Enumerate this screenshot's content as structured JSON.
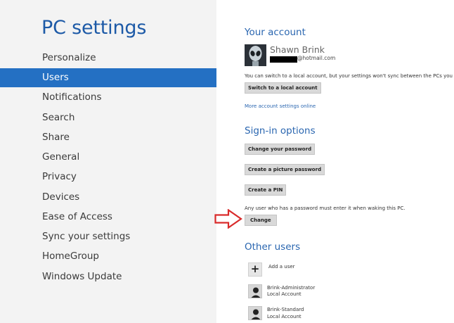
{
  "title": "PC settings",
  "nav": {
    "items": [
      {
        "label": "Personalize"
      },
      {
        "label": "Users"
      },
      {
        "label": "Notifications"
      },
      {
        "label": "Search"
      },
      {
        "label": "Share"
      },
      {
        "label": "General"
      },
      {
        "label": "Privacy"
      },
      {
        "label": "Devices"
      },
      {
        "label": "Ease of Access"
      },
      {
        "label": "Sync your settings"
      },
      {
        "label": "HomeGroup"
      },
      {
        "label": "Windows Update"
      }
    ],
    "selected": "Users"
  },
  "account": {
    "heading": "Your account",
    "user_name": "Shawn Brink",
    "email_domain": "@hotmail.com",
    "info": "You can switch to a local account, but your settings won't sync between the PCs you use.",
    "switch_button": "Switch to a local account",
    "more_link": "More account settings online"
  },
  "signin": {
    "heading": "Sign-in options",
    "change_password_button": "Change your password",
    "picture_password_button": "Create a picture password",
    "pin_button": "Create a PIN",
    "wake_text": "Any user who has a password must enter it when waking this PC.",
    "change_button": "Change"
  },
  "other_users": {
    "heading": "Other users",
    "add_label": "Add a user",
    "add_symbol": "+",
    "users": [
      {
        "name": "Brink-Administrator",
        "type": "Local Account"
      },
      {
        "name": "Brink-Standard",
        "type": "Local Account"
      }
    ]
  },
  "colors": {
    "accent": "#2470c3",
    "heading": "#2a66b0",
    "arrow": "#d92b2b",
    "left_pane": "#f3f3f3"
  }
}
